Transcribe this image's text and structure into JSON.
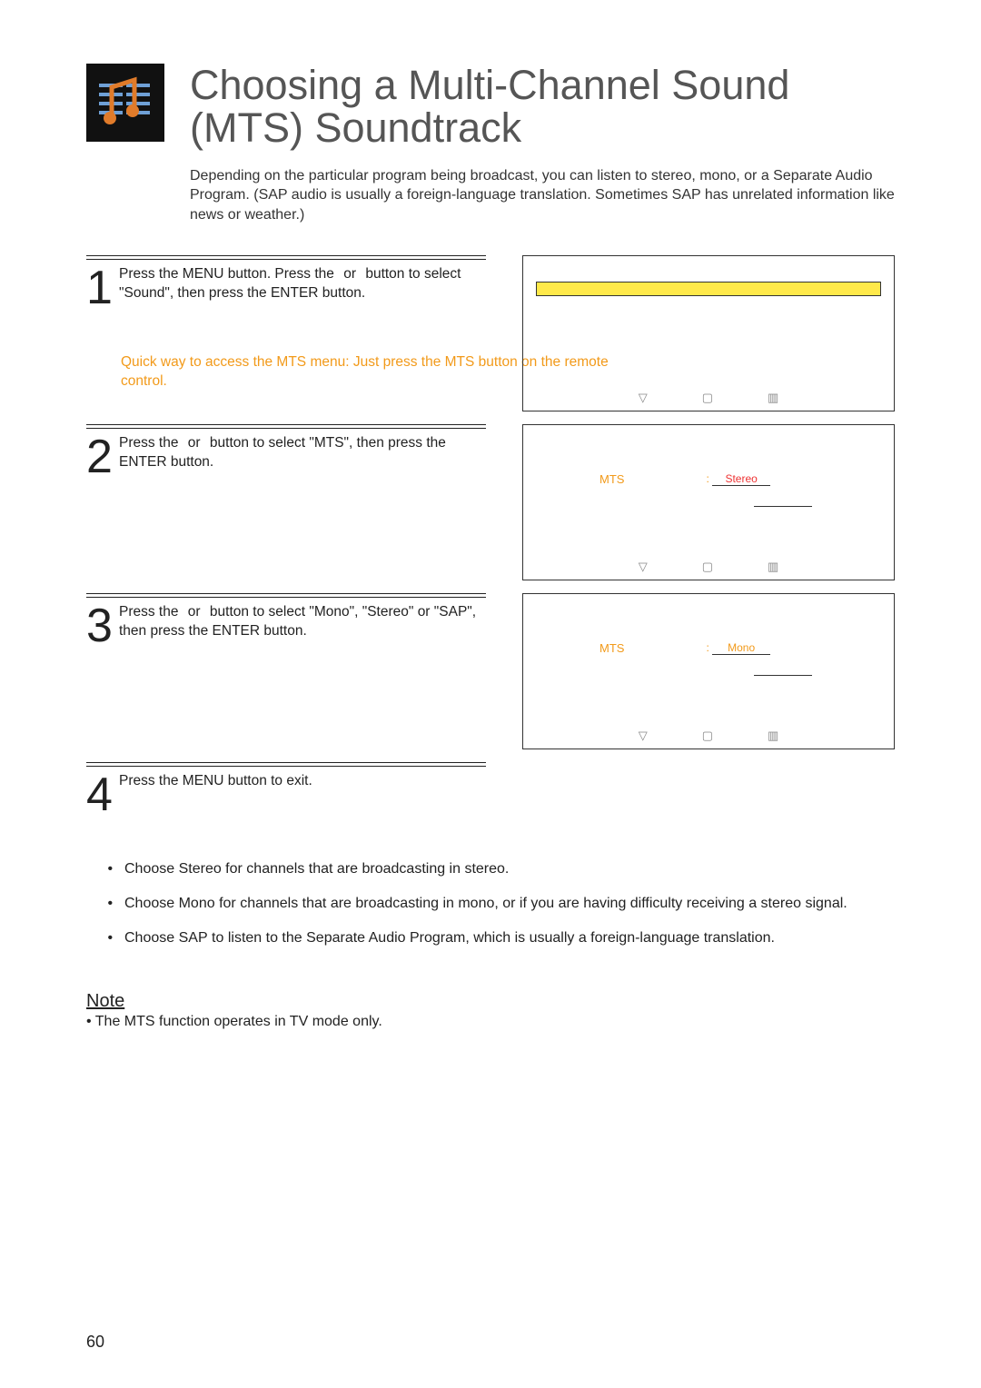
{
  "header": {
    "title": "Choosing a Multi-Channel Sound (MTS) Soundtrack",
    "intro": "Depending on the particular program being broadcast, you can listen to stereo, mono, or a Separate Audio Program. (SAP audio is usually a foreign-language translation. Sometimes SAP has unrelated information like news or weather.)"
  },
  "steps": {
    "s1": {
      "num": "1",
      "text_a": "Press the MENU button. Press the ",
      "or": "or",
      "text_b": " button to select \"Sound\", then press the ENTER button.",
      "hint": "Quick way to access the MTS menu: Just press the MTS button on the remote control."
    },
    "s2": {
      "num": "2",
      "text_a": "Press the ",
      "or": "or",
      "text_b": " button to select \"MTS\", then press the ENTER button."
    },
    "s3": {
      "num": "3",
      "text_a": "Press the ",
      "or": "or",
      "text_b": " button to select \"Mono\", \"Stereo\" or \"SAP\", then press the ENTER button."
    },
    "s4": {
      "num": "4",
      "text": "Press the MENU button to exit."
    }
  },
  "screens": {
    "s2": {
      "label": "MTS",
      "colon": ":",
      "value": "Stereo"
    },
    "s3": {
      "label": "MTS",
      "colon": ":",
      "value": "Mono"
    }
  },
  "bullets": {
    "b1a": "Choose ",
    "b1b": "Stereo",
    "b1c": " for channels that are broadcasting in stereo.",
    "b2a": "Choose ",
    "b2b": "Mono",
    "b2c": " for channels that are broadcasting in mono, or if you are having difficulty receiving a stereo signal.",
    "b3a": "Choose ",
    "b3b": "SAP",
    "b3c": " to listen to the Separate Audio Program, which is usually a foreign-language translation."
  },
  "note": {
    "head": "Note",
    "body": "The MTS function operates in TV mode only."
  },
  "page": "60",
  "icons": {
    "down": "▽",
    "pip": "▢",
    "bars": "▥"
  }
}
